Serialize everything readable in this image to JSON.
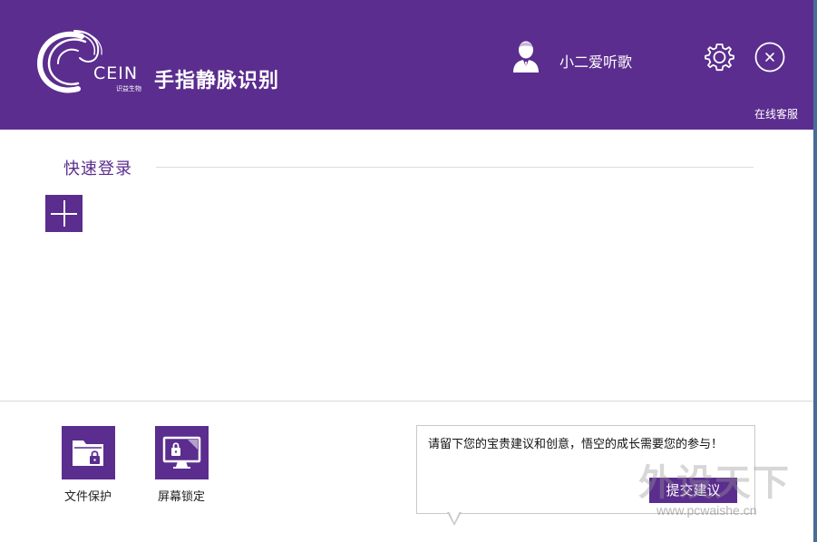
{
  "header": {
    "logo_text": "CEIN",
    "logo_subtext": "识益生物",
    "app_title": "手指静脉识别",
    "username": "小二爱听歌",
    "online_service": "在线客服",
    "icons": [
      "user-avatar-icon",
      "gear-icon",
      "close-icon"
    ]
  },
  "quick_login": {
    "title": "快速登录",
    "add_icon": "plus-icon"
  },
  "tools": [
    {
      "label": "文件保护",
      "icon": "folder-lock-icon"
    },
    {
      "label": "屏幕锁定",
      "icon": "monitor-lock-icon"
    }
  ],
  "feedback": {
    "prompt": "请留下您的宝贵建议和创意，悟空的成长需要您的参与！",
    "submit_label": "提交建议"
  },
  "watermark": {
    "text": "外设天下",
    "url": "www.pcwaishe.cn"
  },
  "colors": {
    "brand_purple": "#5b2d8e",
    "background": "#ffffff"
  }
}
